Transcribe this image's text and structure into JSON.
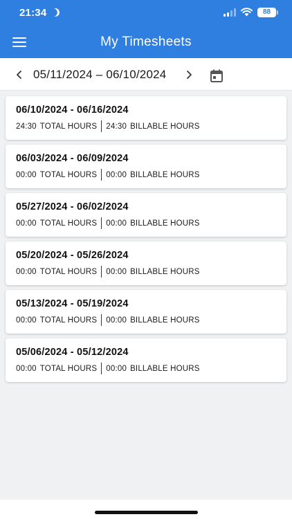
{
  "status_bar": {
    "time": "21:34",
    "battery": "88"
  },
  "app_bar": {
    "title": "My Timesheets",
    "menu_icon": "hamburger-menu-icon"
  },
  "range": {
    "label": "05/11/2024 – 06/10/2024",
    "prev_icon": "chevron-left-icon",
    "next_icon": "chevron-right-icon",
    "calendar_icon": "calendar-icon"
  },
  "timesheets": [
    {
      "period": "06/10/2024 - 06/16/2024",
      "total_hours": "24:30",
      "total_label": "TOTAL HOURS",
      "billable_hours": "24:30",
      "billable_label": "BILLABLE HOURS"
    },
    {
      "period": "06/03/2024 - 06/09/2024",
      "total_hours": "00:00",
      "total_label": "TOTAL HOURS",
      "billable_hours": "00:00",
      "billable_label": "BILLABLE HOURS"
    },
    {
      "period": "05/27/2024 - 06/02/2024",
      "total_hours": "00:00",
      "total_label": "TOTAL HOURS",
      "billable_hours": "00:00",
      "billable_label": "BILLABLE HOURS"
    },
    {
      "period": "05/20/2024 - 05/26/2024",
      "total_hours": "00:00",
      "total_label": "TOTAL HOURS",
      "billable_hours": "00:00",
      "billable_label": "BILLABLE HOURS"
    },
    {
      "period": "05/13/2024 - 05/19/2024",
      "total_hours": "00:00",
      "total_label": "TOTAL HOURS",
      "billable_hours": "00:00",
      "billable_label": "BILLABLE HOURS"
    },
    {
      "period": "05/06/2024 - 05/12/2024",
      "total_hours": "00:00",
      "total_label": "TOTAL HOURS",
      "billable_hours": "00:00",
      "billable_label": "BILLABLE HOURS"
    }
  ],
  "colors": {
    "primary": "#2f7fe0",
    "background": "#f0f1f2",
    "card": "#ffffff"
  }
}
